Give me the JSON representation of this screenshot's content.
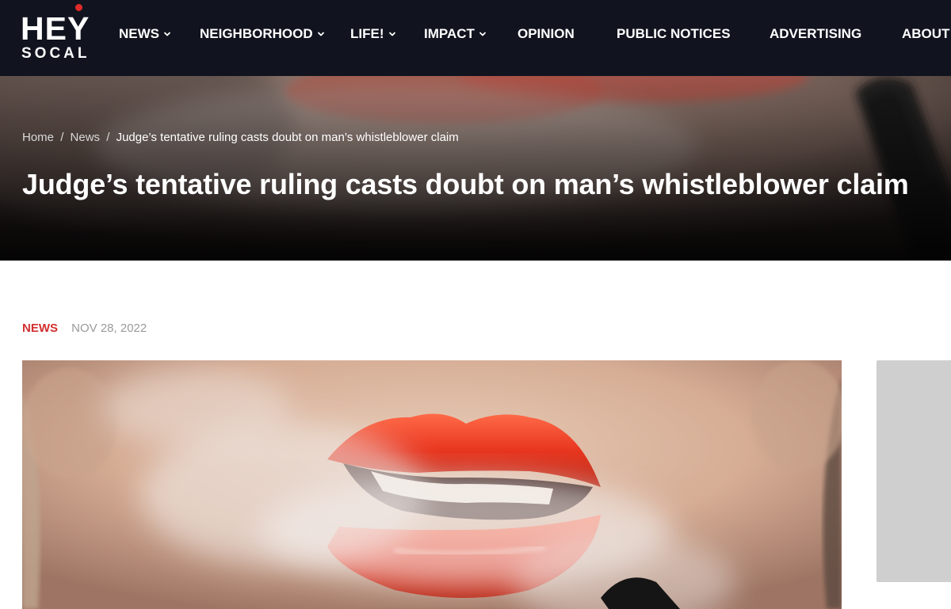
{
  "brand": {
    "logo_top": "HEY",
    "logo_bottom": "SOCAL"
  },
  "nav": {
    "items": [
      {
        "label": "NEWS",
        "has_dropdown": true
      },
      {
        "label": "NEIGHBORHOOD",
        "has_dropdown": true
      },
      {
        "label": "LIFE!",
        "has_dropdown": true
      },
      {
        "label": "IMPACT",
        "has_dropdown": true
      },
      {
        "label": "OPINION",
        "has_dropdown": false
      },
      {
        "label": "PUBLIC NOTICES",
        "has_dropdown": false
      },
      {
        "label": "ADVERTISING",
        "has_dropdown": false
      },
      {
        "label": "ABOUT",
        "has_dropdown": false
      }
    ]
  },
  "breadcrumb": {
    "home": "Home",
    "sep1": "/",
    "section": "News",
    "sep2": "/",
    "current": "Judge’s tentative ruling casts doubt on man’s whistleblower claim"
  },
  "article": {
    "title": "Judge’s tentative ruling casts doubt on man’s whistleblower claim",
    "category": "NEWS",
    "date": "NOV 28, 2022"
  },
  "colors": {
    "nav_bg": "#11141f",
    "accent_red": "#d32f2f",
    "date_gray": "#9a9a9a"
  },
  "icons": {
    "dropdown": "chevron-down-icon"
  }
}
